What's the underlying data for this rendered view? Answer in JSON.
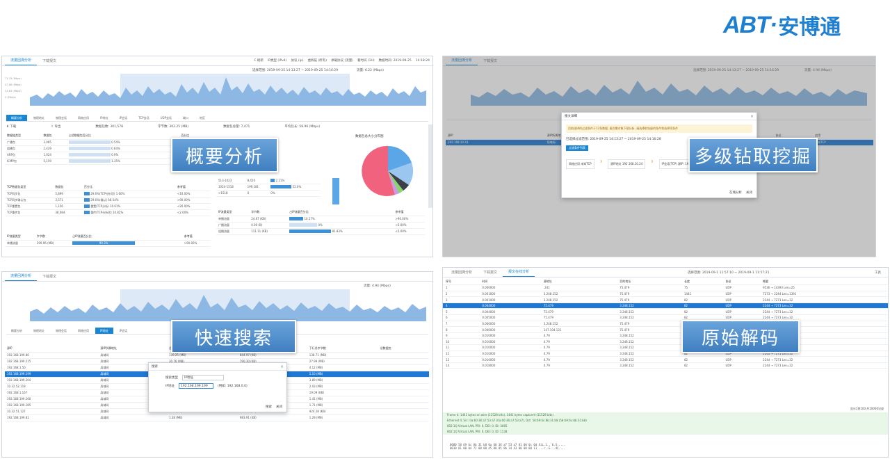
{
  "logo": {
    "latin": "ABT",
    "dot": "·",
    "chinese": "安博通"
  },
  "panels": {
    "p1": {
      "tabs": [
        "流量回溯分析",
        "下载报文"
      ],
      "toolbar": [
        "C 刷新",
        "IP类型 (IPv4)",
        "协议 (ip)",
        "虚拟链 (所有)",
        "承载协议 (流量)",
        "看时间 (1H)",
        "数据时间: 2019-09-25",
        "14:18:24"
      ],
      "timerange": "选择范围: 2019-09-25 14:13:27 ~ 2019-09-25 14:16:29",
      "flow": "流量: 6.22 (Mbps)",
      "y_ticks": [
        "71.33 (Mbps)",
        "47.66 (Mbps)",
        "23.83 (Mbps)",
        "0 (Mbps)"
      ],
      "subtabs": [
        "概要分析",
        "物理地址",
        "物理会话",
        "网络应用",
        "IP地址",
        "IP会话",
        "TCP会话",
        "UDP会话",
        "端口",
        "地区"
      ],
      "stats": [
        "数据包数: 301,578",
        "字节数: 302.25 (MB)",
        "数据包总量: 7,471",
        "平均包长: 58.96 (Mbps)"
      ],
      "table1_head": [
        "数据链类型",
        "数据包",
        "占总数据包百分比",
        "百分比"
      ],
      "table1_rows": [
        [
          "广播包",
          "3,065",
          "0.54%",
          "<10.00%"
        ],
        [
          "组播包",
          "2,429",
          "0.64%",
          "<10.00%"
        ],
        [
          "ARP包",
          "1,024",
          "0.9%",
          "<10.00%"
        ],
        [
          "ICMP包",
          "5,159",
          "1.35%",
          "<10.00%"
        ]
      ],
      "table2_head": [
        "TCP数据包类型",
        "数据包",
        "百分比",
        "参考值"
      ],
      "table2_rows": [
        [
          "TCP同步包",
          "5,899",
          "29.6%(TCP分析项) 1.60%",
          "<10.00%"
        ],
        [
          "TCP同步确认包",
          "3,571",
          "29.6%(确认) 68.54%",
          ">90.00%"
        ],
        [
          "TCP重置包",
          "1,156",
          "重置(TCP分析) 10.61%",
          "<20.00%"
        ],
        [
          "TCP重传包",
          "38,084",
          "重传(TCP分析项) 10.82%",
          "<2.00%"
        ]
      ],
      "table3_head": [
        "IP流量类型",
        "字节数",
        "占IP流量百分比",
        "参考值"
      ],
      "table3_rows": [
        [
          "单播流量",
          "299.96 (MB)",
          "99.3%",
          ">90.00%"
        ]
      ],
      "table4_rows": [
        [
          "513-1023",
          "8,450",
          "2.21%"
        ],
        [
          "1024-1518",
          "199,181",
          "52.0%"
        ],
        [
          ">1518",
          "0",
          "0%"
        ]
      ],
      "table5_head": [
        "IP流量类型",
        "字节数",
        "占IP流量百分比",
        "参考值"
      ],
      "table5_rows": [
        [
          "单播流量",
          "24.67 (KB)",
          "10.17%",
          ">90.00%"
        ],
        [
          "广播流量",
          "0.00 (B)",
          "0%",
          "<5.00%"
        ],
        [
          "组播流量",
          "111.11 (KB)",
          "81.83%",
          "<5.00%"
        ]
      ],
      "pie_title": "数据包总大小分布图",
      "callout": "概要分析"
    },
    "p2": {
      "tabs": [
        "流量回溯分析",
        "下载报文"
      ],
      "timerange": "选择范围: 2019-09-25 14:13:27 ~ 2019-09-25 14:16:29",
      "flow": "流量: 4.94 (Mbps)",
      "dialog_title": "报文详细",
      "dialog_notice": "目前选择的过滤条件于12条数据, 级别需对象下载分析, 请选择前钻级的条件和选择项条件",
      "dialog_range": "已选择过滤范围:  2019-09-25 14:13:27 ~ 2019-09-25 14:16:28",
      "dialog_btn": "过滤条件列表",
      "flow_nodes": [
        "网络应用 未知TCP",
        "源IP地址 192.168.10.24",
        "IP会话(TCP) 源IP: 192.168.10.24 目的IP: 192.168.10.101"
      ],
      "dialog_actions": [
        "在线分析",
        "关闭"
      ],
      "row": [
        "192.168.10.24",
        "局域网",
        "",
        "",
        "",
        "192",
        "TCP",
        "未知TCP"
      ],
      "callout": "多级钻取挖掘"
    },
    "p3": {
      "tabs": [
        "流量回溯分析",
        "下载报文"
      ],
      "flow": "流量: 4.94 (Mbps)",
      "subtabs": [
        "概要分析",
        "物理地址",
        "物理会话",
        "网络应用",
        "IP地址",
        "IP会话"
      ],
      "head": [
        "源IP",
        "源IP所属地址",
        "总字节数",
        "上行总字节数",
        "下行总字节数",
        "总数据包"
      ],
      "rows": [
        [
          "192.168.199.86",
          "局域网",
          "139.25 (MB)",
          "844.97 (KB)",
          "138.71 (MB)"
        ],
        [
          "192.168.199.215",
          "局域网",
          "30.76 (MB)",
          "790.30 (KB)",
          "27.99 (MB)"
        ],
        [
          "192.168.1.50",
          "局域网",
          "5.54 (MB)",
          "1.41 (MB)",
          "4.12 (MB)"
        ],
        [
          "192.168.199.199",
          "局域网",
          "5.26 (MB)",
          "168.64 (KB)",
          "5.10 (MB)"
        ],
        [
          "192.168.199.204",
          "局域网",
          "4.03 (MB)",
          "200.00 (KB)",
          "3.89 (MB)"
        ],
        [
          "10.32.52.118",
          "局域网",
          "2.16 (MB)",
          "58.00 (KB)",
          "2.03 (MB)"
        ],
        [
          "192.168.1.167",
          "局域网",
          "2.11 (MB)",
          "2.09 (MB)",
          "19.09 (KB)"
        ],
        [
          "192.168.199.160",
          "局域网",
          "1.86 (MB)",
          "556.14 (KB)",
          "1.41 (MB)"
        ],
        [
          "192.168.199.185",
          "局域网",
          "1.84 (MB)",
          "137.96 (KB)",
          "1.71 (MB)"
        ],
        [
          "10.32.51.127",
          "局域网",
          "1.80 (MB)",
          "918.68 (KB)",
          "924.28 (KB)"
        ],
        [
          "192.168.199.81",
          "局域网",
          "1.38 (MB)",
          "983.91 (KB)",
          "1.29 (MB)"
        ]
      ],
      "dialog_title": "搜索",
      "field1_label": "搜索类型",
      "field1_value": "IP地址",
      "field2_label": "IP地址",
      "field2_value": "192.168.199.199",
      "field2_hint": "(例如: 192.168.0.0)",
      "dialog_actions": [
        "搜索",
        "关闭"
      ],
      "callout": "快速搜索"
    },
    "p4": {
      "tabs": [
        "流量回溯分析",
        "下载报文",
        "报文在线分析"
      ],
      "range": "选择范围: 2019-09-1 11:57:10 ~ 2019-09-1 11:57:21",
      "tools": "工具",
      "head": [
        "序号",
        "时间",
        "源地址",
        "目的地址",
        "长度",
        "协议",
        "概要"
      ],
      "rows": [
        [
          "1",
          "0.000000",
          ".241",
          "75.479",
          "75",
          "UDP",
          "9536 → 14393 Len=25"
        ],
        [
          "2",
          "0.001000",
          "3.248.152",
          "75.479",
          "1441",
          "UDP",
          "7273 → 2244 Len=1391"
        ],
        [
          "3",
          "0.001000",
          "3.248.152",
          "75.479",
          "82",
          "UDP",
          "2244 → 7273 Len=32"
        ],
        [
          "4",
          "0.004000",
          "75.479",
          "3.248.152",
          "82",
          "UDP",
          "2244 → 7273 Len=32"
        ],
        [
          "5",
          "0.004000",
          "75.479",
          "3.248.152",
          "82",
          "UDP",
          "2244 → 7273 Len=32"
        ],
        [
          "6",
          "0.005000",
          "75.479",
          "3.248.152",
          "82",
          "UDP",
          "2244 → 7273 Len=32"
        ],
        [
          "7",
          "0.006000",
          "3.248.152",
          "75.479",
          "1441",
          "UDP",
          "7273 → 2244 Len=1391"
        ],
        [
          "8",
          "0.006000",
          "147.104.131",
          "75.479",
          "78",
          "UDP",
          "16855 → 14393 Len=28"
        ],
        [
          "9",
          "0.010000",
          "4.79",
          "3.248.152",
          "82",
          "UDP",
          "2244 → 7273 Len=32"
        ],
        [
          "10",
          "0.010000",
          "4.79",
          "3.248.152",
          "1441",
          "UDP",
          "7273 → 2244 Len=1391"
        ],
        [
          "11",
          "0.010000",
          "4.79",
          "3.248.152",
          "1441",
          "UDP",
          "7273 → 2244 Len=1391"
        ],
        [
          "12",
          "0.010000",
          "4.79",
          "3.248.152",
          "82",
          "UDP",
          "2244 → 7273 Len=32"
        ],
        [
          "13",
          "0.016000",
          "4.79",
          "3.248.152",
          "82",
          "UDP",
          "2244 → 7273 Len=32"
        ],
        [
          "14",
          "0.018000",
          "4.79",
          "3.248.152",
          "82",
          "UDP",
          "2244 → 7273 Len=32"
        ]
      ],
      "paging": "显示1到100,共10000记录",
      "details": [
        "Frame 4: 1441 bytes on wire (11528 bits), 1441 bytes captured (11528 bits)",
        "Ethernet II, Src: 0a:60:36:a7:53:a7 (0a:60:36:a7:53:a7), Dst: 58:69:6c:8b:31:b8 (58:69:6c:8b:31:b8)",
        "802.1Q Virtual LAN, PRI: 0, DEI: 0, ID: 3085",
        "802.1Q Virtual LAN, PRI: 0, DEI: 0, ID: 1138"
      ],
      "hex": [
        "0000  58 69 6c 8b 31 b8 0a 60 36 a7 53 a7 81 00 0c 0d   XiL.1..`6.S.....",
        "0010  81 00 04 72 08 00 45 00 05 9b 34 43 00 00 80 11   ...r..E...4C...."
      ],
      "callout": "原始解码"
    }
  }
}
